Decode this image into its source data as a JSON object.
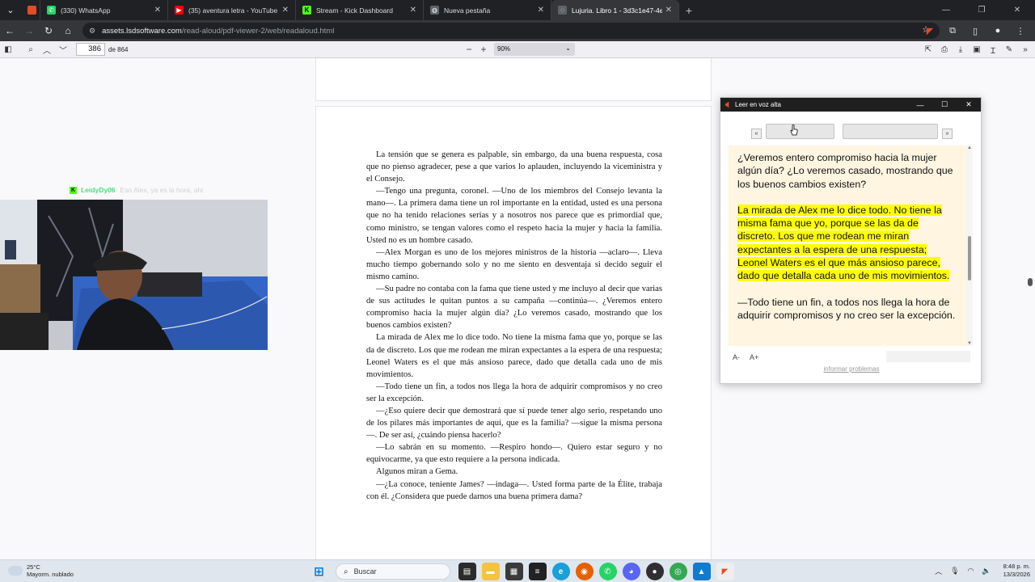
{
  "tabs": [
    {
      "title": "",
      "color": "#e34c26",
      "letter": ""
    },
    {
      "title": "(330) WhatsApp",
      "color": "#25d366",
      "letter": "✆"
    },
    {
      "title": "(35) aventura letra - YouTube",
      "color": "#ff0000",
      "letter": "▶"
    },
    {
      "title": "Stream - Kick Dashboard",
      "color": "#53fc18",
      "letter": "K"
    },
    {
      "title": "Nueva pestaña",
      "color": "#9aa0a6",
      "letter": "◍"
    },
    {
      "title": "Lujuria. Libro 1 - 3d3c1e47-4e6",
      "color": "#9aa0a6",
      "letter": "◌"
    }
  ],
  "address": {
    "host": "assets.lsdsoftware.com",
    "path": "/read-aloud/pdf-viewer-2/web/readaloud.html"
  },
  "pdf": {
    "page_number": "386",
    "page_total": "de 864",
    "zoom": "90%"
  },
  "book": {
    "paragraphs": [
      "La tensión que se genera es palpable, sin embargo, da una buena respuesta, cosa que no pienso agradecer, pese a que varios lo aplauden, incluyendo la viceministra y el Consejo.",
      "—Tengo una pregunta, coronel. —Uno de los miembros del Consejo levanta la mano—. La primera dama tiene un rol importante en la entidad, usted es una persona que no ha tenido relaciones serias y a nosotros nos parece que es primordial que, como ministro, se tengan valores como el respeto hacia la mujer y hacia la familia. Usted no es un hombre casado.",
      "—Alex Morgan es uno de los mejores ministros de la historia —aclaro—. Lleva mucho tiempo gobernando solo y no me siento en desventaja si decido seguir el mismo camino.",
      "—Su padre no contaba con la fama que tiene usted y me incluyo al decir que varias de sus actitudes le quitan puntos a su campaña —continúa—. ¿Veremos entero compromiso hacia la mujer algún día? ¿Lo veremos casado, mostrando que los buenos cambios existen?",
      "La mirada de Alex me lo dice todo. No tiene la misma fama que yo, porque se las da de discreto. Los que me rodean me miran expectantes a la espera de una respuesta; Leonel Waters es el que más ansioso parece, dado que detalla cada uno de mis movimientos.",
      "—Todo tiene un fin, a todos nos llega la hora de adquirir compromisos y no creo ser la excepción.",
      "—¿Eso quiere decir que demostrará que sí puede tener algo serio, respetando uno de los pilares más importantes de aquí, que es la familia? —sigue la misma persona—. De ser así, ¿cuándo piensa hacerlo?",
      "—Lo sabrán en su momento. —Respiro hondo—. Quiero estar seguro y no equivocarme, ya que esto requiere a la persona indicada.",
      "Algunos miran a Gema.",
      "—¿La conoce, teniente James? —indaga—. Usted forma parte de la Élite, trabaja con él. ¿Considera que puede darnos una buena primera dama?"
    ]
  },
  "chat": {
    "user": "LeidyDy06",
    "message": "Eso Alex, ya es la hora, ahi"
  },
  "read_aloud": {
    "title": "Leer en voz alta",
    "prev": "«",
    "next": "»",
    "para1": "¿Veremos entero compromiso hacia la mujer algún día? ¿Lo veremos casado, mostrando que los buenos cambios existen?",
    "para2_highlight": "La mirada de Alex me lo dice todo. No tiene la misma fama que yo, porque se las da de discreto. Los que me rodean me miran expectantes a la espera de una respuesta; Leonel Waters es el que más ansioso parece, dado que detalla cada uno de mis movimientos.",
    "para3": "—Todo tiene un fin, a todos nos llega la hora de adquirir compromisos y no creo ser la excepción.",
    "font_down": "A-",
    "font_up": "A+",
    "report": "informar problemas"
  },
  "taskbar": {
    "temp": "25°C",
    "weather": "Mayorm. nublado",
    "search": "Buscar",
    "time": "8:48 p. m.",
    "date": "13/3/2026"
  }
}
